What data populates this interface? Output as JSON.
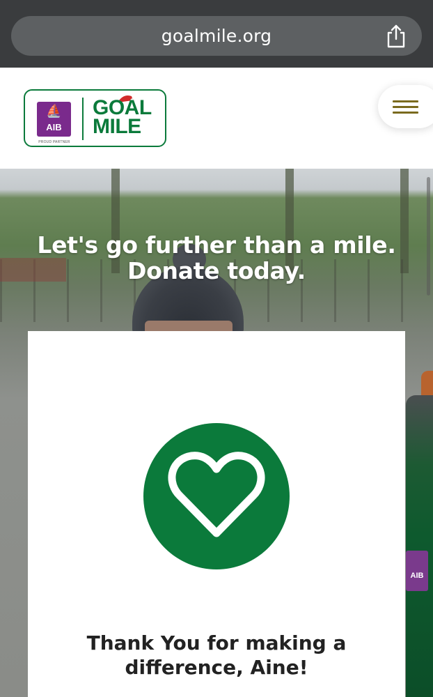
{
  "browser": {
    "url": "goalmile.org",
    "share_icon": "share-icon"
  },
  "header": {
    "logo": {
      "partner_name": "AIB",
      "partner_tagline": "PROUD PARTNER",
      "brand_line1": "GOAL",
      "brand_line2": "MILE"
    },
    "menu_icon": "hamburger-menu-icon"
  },
  "hero": {
    "heading_line1": "Let's go further than a mile.",
    "heading_line2": "Donate today."
  },
  "card": {
    "icon": "heart-icon",
    "message_line1": "Thank You for making a",
    "message_line2": "difference, Aine!"
  },
  "colors": {
    "brand_green": "#0b7a3b",
    "aib_purple": "#7a2a8c",
    "menu_gold": "#7a6a1e"
  }
}
